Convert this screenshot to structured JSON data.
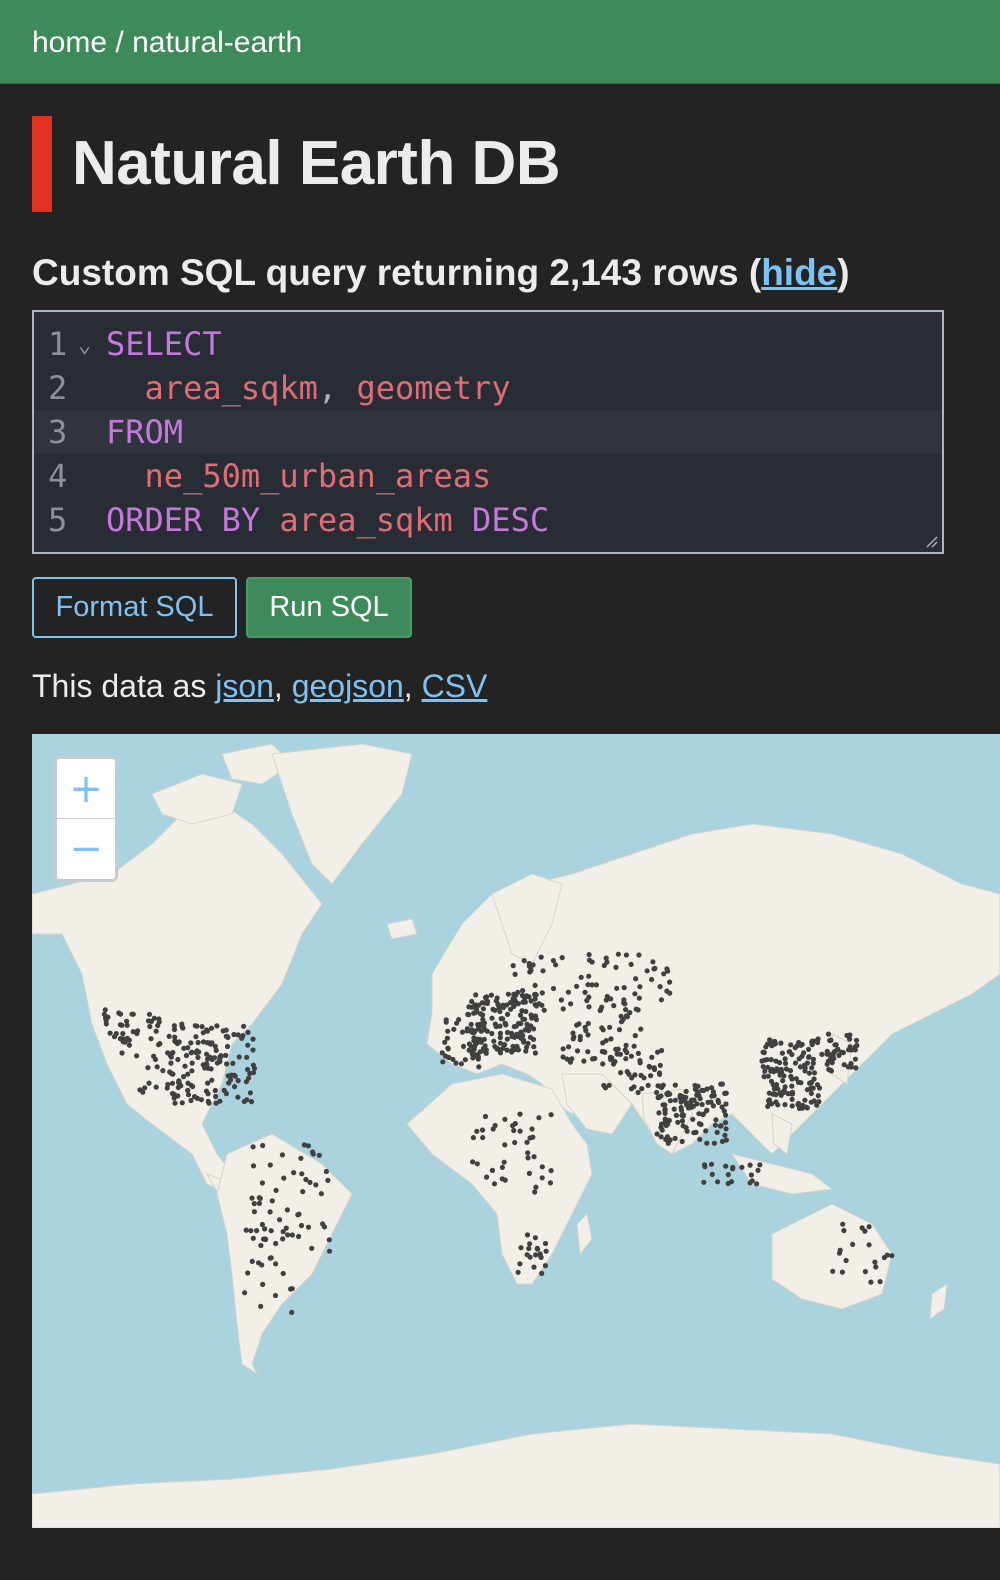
{
  "breadcrumb": {
    "home": "home",
    "separator": "/",
    "database": "natural-earth"
  },
  "page": {
    "title": "Natural Earth DB"
  },
  "query": {
    "heading_prefix": "Custom SQL query returning 2,143 rows (",
    "hide_link": "hide",
    "heading_suffix": ")"
  },
  "editor": {
    "lines": [
      {
        "number": "1",
        "keyword": "SELECT",
        "text": ""
      },
      {
        "number": "2",
        "keyword": "",
        "text": "  area_sqkm, geometry"
      },
      {
        "number": "3",
        "keyword": "FROM",
        "text": ""
      },
      {
        "number": "4",
        "keyword": "",
        "text": "  ne_50m_urban_areas"
      },
      {
        "number": "5",
        "keyword": "ORDER BY",
        "text": " area_sqkm",
        "keyword2": " DESC"
      }
    ],
    "fold_marker": "⌄"
  },
  "buttons": {
    "format": "Format SQL",
    "run": "Run SQL"
  },
  "export": {
    "prefix": "This data as ",
    "json": "json",
    "geojson": "geojson",
    "csv": "CSV",
    "sep": ", "
  },
  "map": {
    "zoom_in": "+",
    "zoom_out": "−",
    "colors": {
      "water": "#aad3df",
      "land": "#f2efe9",
      "points": "#404040"
    }
  }
}
